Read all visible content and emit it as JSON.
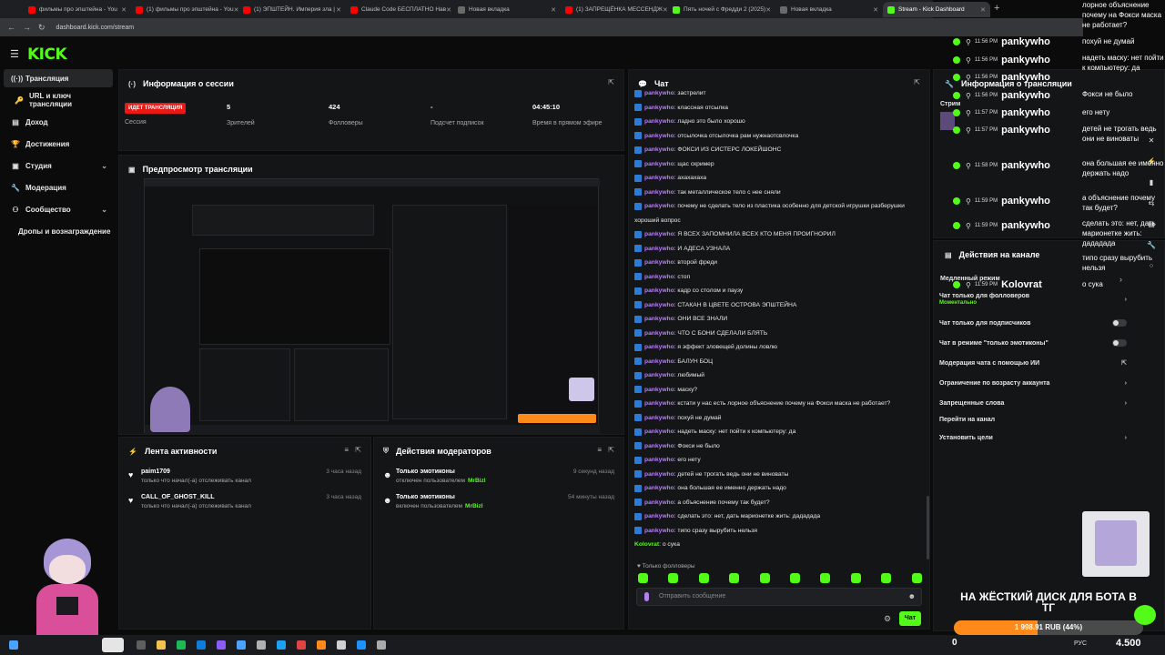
{
  "browser": {
    "tabs": [
      {
        "title": "фильмы про эпштейна - You",
        "color": "#ff0000"
      },
      {
        "title": "(1) фильмы про эпштейна - You",
        "color": "#ff0000"
      },
      {
        "title": "(1) ЭПШТЕЙН. Империя зла |",
        "color": "#ff0000"
      },
      {
        "title": "Claude Code БЕСПЛАТНО Нав",
        "color": "#ff0000"
      },
      {
        "title": "Новая вкладка",
        "color": "#6a6a6a"
      },
      {
        "title": "(1) ЗАПРЕЩЁНКА МЕССЕНДЖ",
        "color": "#ff0000"
      },
      {
        "title": "Пять ночей с Фредди 2 (2025)",
        "color": "#53fc18"
      },
      {
        "title": "Новая вкладка",
        "color": "#6a6a6a"
      },
      {
        "title": "Stream - Kick Dashboard",
        "color": "#53fc18"
      }
    ],
    "url": "dashboard.kick.com/stream"
  },
  "logo": "KICK",
  "sidebar": {
    "items": [
      {
        "label": "Трансляция",
        "icon": "broadcast-icon"
      },
      {
        "label": "URL и ключ трансляции",
        "icon": "key-icon"
      },
      {
        "label": "Доход",
        "icon": "wallet-icon"
      },
      {
        "label": "Достижения",
        "icon": "trophy-icon"
      },
      {
        "label": "Студия",
        "icon": "studio-icon"
      },
      {
        "label": "Модерация",
        "icon": "wrench-icon"
      },
      {
        "label": "Сообщество",
        "icon": "community-icon"
      },
      {
        "label": "Дропы и вознаграждение",
        "icon": ""
      }
    ]
  },
  "session": {
    "title": "Информация о сессии",
    "live_badge": "ИДЕТ ТРАНСЛЯЦИЯ",
    "session_label": "Сессия",
    "viewers": "5",
    "viewers_label": "Зрителей",
    "followers": "424",
    "followers_label": "Фолловеры",
    "subs": "-",
    "subs_label": "Подсчет подписок",
    "uptime": "04:45:10",
    "uptime_label": "Время в прямом эфире"
  },
  "preview": {
    "title": "Предпросмотр трансляции"
  },
  "activity": {
    "title": "Лента активности",
    "items": [
      {
        "name": "paim1709",
        "sub": "только что начал(-а) отслеживать канал",
        "time": "3 часа назад"
      },
      {
        "name": "CALL_OF_GHOST_KILL",
        "sub": "только что начал(-а) отслеживать канал",
        "time": "3 часа назад"
      }
    ]
  },
  "modactions": {
    "title": "Действия модераторов",
    "items": [
      {
        "name": "Только эмотиконы",
        "sub": "отключен пользователем",
        "user": "MrBizl",
        "time": "9 секунд назад"
      },
      {
        "name": "Только эмотиконы",
        "sub": "включен пользователем",
        "user": "MrBizl",
        "time": "54 минуты назад"
      }
    ]
  },
  "chat": {
    "title": "Чат",
    "messages": [
      {
        "user": "pankywho",
        "text": ": застрелит"
      },
      {
        "user": "pankywho",
        "text": ": классная отсылка"
      },
      {
        "user": "pankywho",
        "text": ": ладно это было хорошо"
      },
      {
        "user": "pankywho",
        "text": ": отсылочка отсылочка рам нужнаотсвлочка"
      },
      {
        "user": "pankywho",
        "text": ": ФОКСИ ИЗ СИСТЕРС ЛОКЕЙШОНС"
      },
      {
        "user": "pankywho",
        "text": ": щас скример"
      },
      {
        "user": "pankywho",
        "text": ": ахахахаха"
      },
      {
        "user": "pankywho",
        "text": ": так металлическое тело с нее сняли"
      },
      {
        "user": "pankywho",
        "text": ": почему не сделать тело из пластика особенно для детской игрушки разберушки"
      },
      {
        "user": "",
        "text": "хороший вопрос"
      },
      {
        "user": "pankywho",
        "text": ": Я ВСЕХ ЗАПОМНИЛА ВСЕХ КТО МЕНЯ ПРОИГНОРИЛ"
      },
      {
        "user": "pankywho",
        "text": ": И АДЕСА УЗНАЛА"
      },
      {
        "user": "pankywho",
        "text": ": второй фреди"
      },
      {
        "user": "pankywho",
        "text": ": стоп"
      },
      {
        "user": "pankywho",
        "text": ": кадр со столом и паузу"
      },
      {
        "user": "pankywho",
        "text": ": СТАКАН В ЦВЕТЕ ОСТРОВА ЭПШТЕЙНА"
      },
      {
        "user": "pankywho",
        "text": ": ОНИ ВСЕ ЗНАЛИ"
      },
      {
        "user": "pankywho",
        "text": ": ЧТО С БОНИ СДЕЛАЛИ БЛЯТЬ"
      },
      {
        "user": "pankywho",
        "text": ": я эффект зловещей долины ловлю"
      },
      {
        "user": "pankywho",
        "text": ": БАЛУН БОЦ"
      },
      {
        "user": "pankywho",
        "text": ": любимый"
      },
      {
        "user": "pankywho",
        "text": ": маску?"
      },
      {
        "user": "pankywho",
        "text": ": кстати у нас есть лорное объяснение почему на Фокси маска не работает?"
      },
      {
        "user": "pankywho",
        "text": ": похуй не думай"
      },
      {
        "user": "pankywho",
        "text": ": надеть маску: нет пойти к компьютеру: да"
      },
      {
        "user": "pankywho",
        "text": ": Фокси не было"
      },
      {
        "user": "pankywho",
        "text": ": его нету"
      },
      {
        "user": "pankywho",
        "text": ": детей не трогать ведь они не виноваты"
      },
      {
        "user": "pankywho",
        "text": ": она большая ее именно держать надо"
      },
      {
        "user": "pankywho",
        "text": ": а объяснение почему так будет?"
      },
      {
        "user": "pankywho",
        "text": ": сделать это: нет, дать марионетке жить: дададада"
      },
      {
        "user": "pankywho",
        "text": ": типо сразу вырубить нельзя"
      },
      {
        "user": "Kolovrat",
        "text": ": о сука"
      }
    ],
    "followers_only": "Только фолловеры",
    "placeholder": "Отправить сообщение",
    "send": "Чат"
  },
  "stream_info": {
    "title": "Информация о трансляции",
    "stream_label": "Стрим"
  },
  "channel_actions": {
    "title": "Действия на канале",
    "mode_label": "Медленный режим",
    "items": [
      {
        "label": "Чат только для фолловеров",
        "sub": "Моментально"
      },
      {
        "label": "Чат только для подписчиков"
      },
      {
        "label": "Чат в режиме \"только эмотиконы\""
      },
      {
        "label": "Модерация чата с помощью ИИ"
      },
      {
        "label": "Ограничение по возрасту аккаунта"
      },
      {
        "label": "Запрещенные слова"
      },
      {
        "label": "Перейти на канал"
      },
      {
        "label": "Установить цели"
      }
    ]
  },
  "overlay": {
    "rows": [
      {
        "time": "11:56 PM",
        "name": "pankywho"
      },
      {
        "time": "11:56 PM",
        "name": "pankywho"
      },
      {
        "time": "11:56 PM",
        "name": "pankywho"
      },
      {
        "time": "11:56 PM",
        "name": "pankywho"
      },
      {
        "time": "11:57 PM",
        "name": "pankywho"
      },
      {
        "time": "11:57 PM",
        "name": "pankywho"
      },
      {
        "time": "11:58 PM",
        "name": "pankywho"
      },
      {
        "time": "11:59 PM",
        "name": "pankywho"
      },
      {
        "time": "11:59 PM",
        "name": "pankywho"
      },
      {
        "time": "11:59 PM",
        "name": "Kolovrat"
      }
    ],
    "texts": [
      "лорное объяснение почему на Фокси маска не работает?",
      "похуй не думай",
      "надеть маску: нет пойти к компьютеру: да",
      "Фокси не было",
      "его нету",
      "детей не трогать ведь они не виноваты",
      "она большая ее именно держать надо",
      "а объяснение почему так будет?",
      "сделать это: нет, дать марионетке жить: дададада",
      "типо сразу вырубить нельзя",
      "о сука"
    ],
    "goal_title": "НА ЖЁСТКИЙ ДИСК ДЛЯ БОТА В ТГ",
    "goal_amount": "1 998.91 RUB (44%)",
    "goal_progress": 0.44
  },
  "taskbar": {
    "lang": "РУС",
    "counter": "0",
    "follower_count": "4.500"
  }
}
